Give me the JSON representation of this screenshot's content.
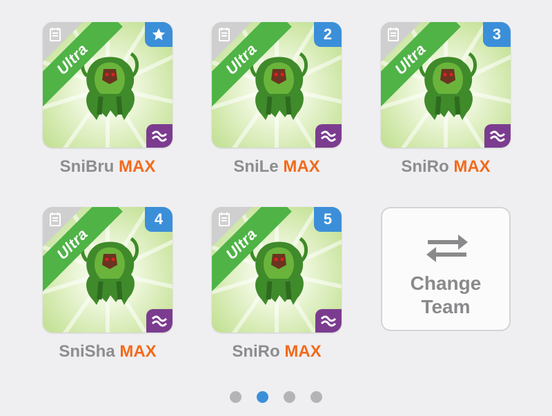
{
  "team": [
    {
      "name": "SniBru",
      "level": "MAX",
      "rarity": "Ultra",
      "slot_badge": "star",
      "element_icon": "water-waves-icon"
    },
    {
      "name": "SniLe",
      "level": "MAX",
      "rarity": "Ultra",
      "slot_badge": "2",
      "element_icon": "water-waves-icon"
    },
    {
      "name": "SniRo",
      "level": "MAX",
      "rarity": "Ultra",
      "slot_badge": "3",
      "element_icon": "water-waves-icon"
    },
    {
      "name": "SniSha",
      "level": "MAX",
      "rarity": "Ultra",
      "slot_badge": "4",
      "element_icon": "water-waves-icon"
    },
    {
      "name": "SniRo",
      "level": "MAX",
      "rarity": "Ultra",
      "slot_badge": "5",
      "element_icon": "water-waves-icon"
    }
  ],
  "change_team": {
    "line1": "Change",
    "line2": "Team",
    "icon": "swap-arrows-icon"
  },
  "pagination": {
    "total": 4,
    "active_page": 2
  },
  "colors": {
    "rarity_ribbon": "#4fb346",
    "slot_badge": "#3b8fd9",
    "element_badge": "#7b3c8f",
    "level_text": "#f26a1b",
    "name_text": "#8d8d8f",
    "active_dot": "#3b8fd9",
    "inactive_dot": "#b4b4b6"
  }
}
